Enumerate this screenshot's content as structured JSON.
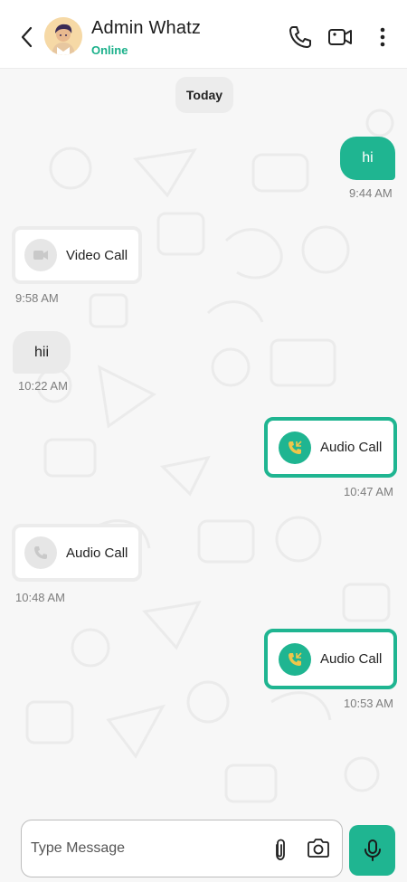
{
  "header": {
    "contact_name": "Admin Whatz",
    "status": "Online",
    "icons": [
      "back-arrow-icon",
      "avatar",
      "phone-icon",
      "video-camera-icon",
      "more-vertical-icon"
    ]
  },
  "chat": {
    "day_separator": "Today",
    "messages": [
      {
        "direction": "out",
        "type": "text",
        "text": "hi",
        "time": "9:44 AM"
      },
      {
        "direction": "in",
        "type": "call",
        "text": "Video Call",
        "time": "9:58 AM"
      },
      {
        "direction": "in",
        "type": "text",
        "text": "hii",
        "time": "10:22 AM"
      },
      {
        "direction": "out",
        "type": "call",
        "text": "Audio Call",
        "time": "10:47 AM"
      },
      {
        "direction": "in",
        "type": "call",
        "text": "Audio Call",
        "time": "10:48 AM"
      },
      {
        "direction": "out",
        "type": "call",
        "text": "Audio Call",
        "time": "10:53 AM"
      }
    ]
  },
  "composer": {
    "placeholder": "Type Message",
    "value": "",
    "icons": [
      "paperclip-icon",
      "camera-icon",
      "microphone-icon"
    ]
  },
  "colors": {
    "accent": "#1fb591",
    "online": "#1ab08a",
    "incoming_bubble": "#eaeaea",
    "time_text": "#7d7d7d"
  }
}
